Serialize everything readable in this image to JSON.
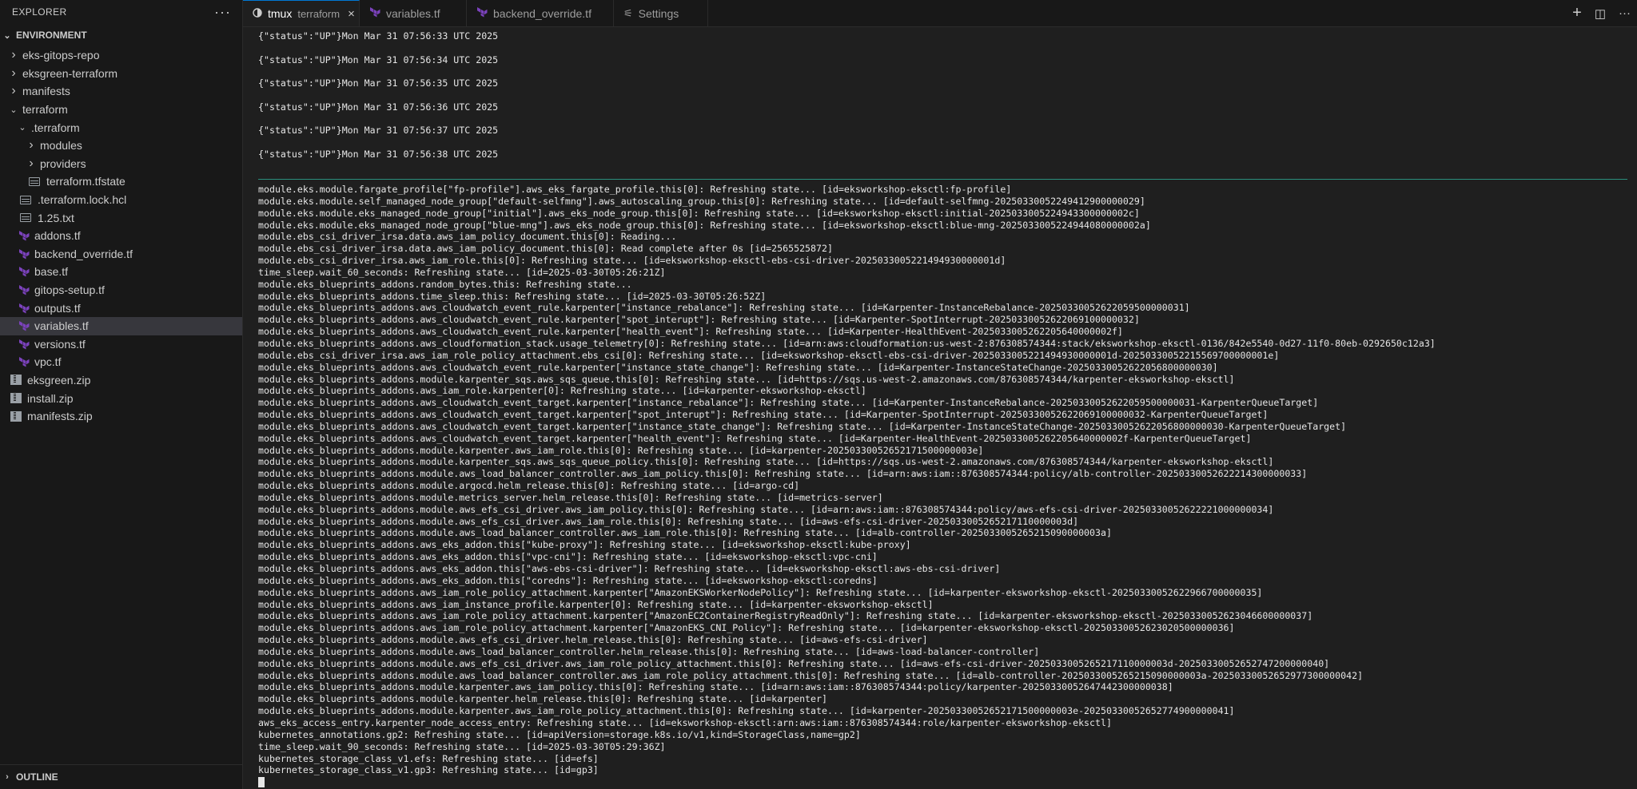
{
  "explorer": {
    "title": "EXPLORER",
    "more": "···",
    "section": "ENVIRONMENT",
    "outline": "OUTLINE",
    "tree": [
      {
        "label": "eks-gitops-repo",
        "kind": "folder",
        "open": false,
        "depth": 0
      },
      {
        "label": "eksgreen-terraform",
        "kind": "folder",
        "open": false,
        "depth": 0
      },
      {
        "label": "manifests",
        "kind": "folder",
        "open": false,
        "depth": 0
      },
      {
        "label": "terraform",
        "kind": "folder",
        "open": true,
        "depth": 0
      },
      {
        "label": ".terraform",
        "kind": "folder",
        "open": true,
        "depth": 1
      },
      {
        "label": "modules",
        "kind": "folder",
        "open": false,
        "depth": 2
      },
      {
        "label": "providers",
        "kind": "folder",
        "open": false,
        "depth": 2
      },
      {
        "label": "terraform.tfstate",
        "kind": "file",
        "depth": 2
      },
      {
        "label": ".terraform.lock.hcl",
        "kind": "file",
        "depth": 1
      },
      {
        "label": "1.25.txt",
        "kind": "file",
        "depth": 1
      },
      {
        "label": "addons.tf",
        "kind": "tf",
        "depth": 1
      },
      {
        "label": "backend_override.tf",
        "kind": "tf",
        "depth": 1
      },
      {
        "label": "base.tf",
        "kind": "tf",
        "depth": 1
      },
      {
        "label": "gitops-setup.tf",
        "kind": "tf",
        "depth": 1
      },
      {
        "label": "outputs.tf",
        "kind": "tf",
        "depth": 1
      },
      {
        "label": "variables.tf",
        "kind": "tf",
        "depth": 1,
        "selected": true
      },
      {
        "label": "versions.tf",
        "kind": "tf",
        "depth": 1
      },
      {
        "label": "vpc.tf",
        "kind": "tf",
        "depth": 1
      },
      {
        "label": "eksgreen.zip",
        "kind": "zip",
        "depth": 0
      },
      {
        "label": "install.zip",
        "kind": "zip",
        "depth": 0
      },
      {
        "label": "manifests.zip",
        "kind": "zip",
        "depth": 0
      }
    ]
  },
  "tabs": [
    {
      "label": "tmux",
      "sub": "terraform",
      "icon": "terminal-icon",
      "active": true,
      "close": "×"
    },
    {
      "label": "variables.tf",
      "icon": "terraform-icon"
    },
    {
      "label": "backend_override.tf",
      "icon": "terraform-icon"
    },
    {
      "label": "Settings",
      "icon": "settings-icon"
    }
  ],
  "tab_actions": {
    "new": "+",
    "split": "◫",
    "more": "···"
  },
  "colors": {
    "terraform": "#7b42bc",
    "accent": "#0078d4",
    "divider": "#2a8f7c",
    "selected": "#37373d"
  },
  "terminal": {
    "status_lines": [
      "{\"status\":\"UP\"}Mon Mar 31 07:56:33 UTC 2025",
      "{\"status\":\"UP\"}Mon Mar 31 07:56:34 UTC 2025",
      "{\"status\":\"UP\"}Mon Mar 31 07:56:35 UTC 2025",
      "{\"status\":\"UP\"}Mon Mar 31 07:56:36 UTC 2025",
      "{\"status\":\"UP\"}Mon Mar 31 07:56:37 UTC 2025",
      "{\"status\":\"UP\"}Mon Mar 31 07:56:38 UTC 2025"
    ],
    "log_lines": [
      "module.eks.module.fargate_profile[\"fp-profile\"].aws_eks_fargate_profile.this[0]: Refreshing state... [id=eksworkshop-eksctl:fp-profile]",
      "module.eks.module.self_managed_node_group[\"default-selfmng\"].aws_autoscaling_group.this[0]: Refreshing state... [id=default-selfmng-20250330052249412900000029]",
      "module.eks.module.eks_managed_node_group[\"initial\"].aws_eks_node_group.this[0]: Refreshing state... [id=eksworkshop-eksctl:initial-2025033005224943300000002c]",
      "module.eks.module.eks_managed_node_group[\"blue-mng\"].aws_eks_node_group.this[0]: Refreshing state... [id=eksworkshop-eksctl:blue-mng-2025033005224944080000002a]",
      "module.ebs_csi_driver_irsa.data.aws_iam_policy_document.this[0]: Reading...",
      "module.ebs_csi_driver_irsa.data.aws_iam_policy_document.this[0]: Read complete after 0s [id=2565525872]",
      "module.ebs_csi_driver_irsa.aws_iam_role.this[0]: Refreshing state... [id=eksworkshop-eksctl-ebs-csi-driver-2025033005221494930000001d]",
      "time_sleep.wait_60_seconds: Refreshing state... [id=2025-03-30T05:26:21Z]",
      "module.eks_blueprints_addons.random_bytes.this: Refreshing state...",
      "module.eks_blueprints_addons.time_sleep.this: Refreshing state... [id=2025-03-30T05:26:52Z]",
      "module.eks_blueprints_addons.aws_cloudwatch_event_rule.karpenter[\"instance_rebalance\"]: Refreshing state... [id=Karpenter-InstanceRebalance-20250330052622059500000031]",
      "module.eks_blueprints_addons.aws_cloudwatch_event_rule.karpenter[\"spot_interupt\"]: Refreshing state... [id=Karpenter-SpotInterrupt-20250330052622069100000032]",
      "module.eks_blueprints_addons.aws_cloudwatch_event_rule.karpenter[\"health_event\"]: Refreshing state... [id=Karpenter-HealthEvent-2025033005262205640000002f]",
      "module.eks_blueprints_addons.aws_cloudformation_stack.usage_telemetry[0]: Refreshing state... [id=arn:aws:cloudformation:us-west-2:876308574344:stack/eksworkshop-eksctl-0136/842e5540-0d27-11f0-80eb-0292650c12a3]",
      "module.ebs_csi_driver_irsa.aws_iam_role_policy_attachment.ebs_csi[0]: Refreshing state... [id=eksworkshop-eksctl-ebs-csi-driver-2025033005221494930000001d-20250330052215569700000001e]",
      "module.eks_blueprints_addons.aws_cloudwatch_event_rule.karpenter[\"instance_state_change\"]: Refreshing state... [id=Karpenter-InstanceStateChange-20250330052622056800000030]",
      "module.eks_blueprints_addons.module.karpenter_sqs.aws_sqs_queue.this[0]: Refreshing state... [id=https://sqs.us-west-2.amazonaws.com/876308574344/karpenter-eksworkshop-eksctl]",
      "module.eks_blueprints_addons.aws_iam_role.karpenter[0]: Refreshing state... [id=karpenter-eksworkshop-eksctl]",
      "module.eks_blueprints_addons.aws_cloudwatch_event_target.karpenter[\"instance_rebalance\"]: Refreshing state... [id=Karpenter-InstanceRebalance-20250330052622059500000031-KarpenterQueueTarget]",
      "module.eks_blueprints_addons.aws_cloudwatch_event_target.karpenter[\"spot_interupt\"]: Refreshing state... [id=Karpenter-SpotInterrupt-20250330052622069100000032-KarpenterQueueTarget]",
      "module.eks_blueprints_addons.aws_cloudwatch_event_target.karpenter[\"instance_state_change\"]: Refreshing state... [id=Karpenter-InstanceStateChange-20250330052622056800000030-KarpenterQueueTarget]",
      "module.eks_blueprints_addons.aws_cloudwatch_event_target.karpenter[\"health_event\"]: Refreshing state... [id=Karpenter-HealthEvent-2025033005262205640000002f-KarpenterQueueTarget]",
      "module.eks_blueprints_addons.module.karpenter.aws_iam_role.this[0]: Refreshing state... [id=karpenter-20250330052652171500000003e]",
      "module.eks_blueprints_addons.module.karpenter_sqs.aws_sqs_queue_policy.this[0]: Refreshing state... [id=https://sqs.us-west-2.amazonaws.com/876308574344/karpenter-eksworkshop-eksctl]",
      "module.eks_blueprints_addons.module.aws_load_balancer_controller.aws_iam_policy.this[0]: Refreshing state... [id=arn:aws:iam::876308574344:policy/alb-controller-20250330052622214300000033]",
      "module.eks_blueprints_addons.module.argocd.helm_release.this[0]: Refreshing state... [id=argo-cd]",
      "module.eks_blueprints_addons.module.metrics_server.helm_release.this[0]: Refreshing state... [id=metrics-server]",
      "module.eks_blueprints_addons.module.aws_efs_csi_driver.aws_iam_policy.this[0]: Refreshing state... [id=arn:aws:iam::876308574344:policy/aws-efs-csi-driver-20250330052622221000000034]",
      "module.eks_blueprints_addons.module.aws_efs_csi_driver.aws_iam_role.this[0]: Refreshing state... [id=aws-efs-csi-driver-2025033005265217110000003d]",
      "module.eks_blueprints_addons.module.aws_load_balancer_controller.aws_iam_role.this[0]: Refreshing state... [id=alb-controller-2025033005265215090000003a]",
      "module.eks_blueprints_addons.aws_eks_addon.this[\"kube-proxy\"]: Refreshing state... [id=eksworkshop-eksctl:kube-proxy]",
      "module.eks_blueprints_addons.aws_eks_addon.this[\"vpc-cni\"]: Refreshing state... [id=eksworkshop-eksctl:vpc-cni]",
      "module.eks_blueprints_addons.aws_eks_addon.this[\"aws-ebs-csi-driver\"]: Refreshing state... [id=eksworkshop-eksctl:aws-ebs-csi-driver]",
      "module.eks_blueprints_addons.aws_eks_addon.this[\"coredns\"]: Refreshing state... [id=eksworkshop-eksctl:coredns]",
      "module.eks_blueprints_addons.aws_iam_role_policy_attachment.karpenter[\"AmazonEKSWorkerNodePolicy\"]: Refreshing state... [id=karpenter-eksworkshop-eksctl-20250330052622966700000035]",
      "module.eks_blueprints_addons.aws_iam_instance_profile.karpenter[0]: Refreshing state... [id=karpenter-eksworkshop-eksctl]",
      "module.eks_blueprints_addons.aws_iam_role_policy_attachment.karpenter[\"AmazonEC2ContainerRegistryReadOnly\"]: Refreshing state... [id=karpenter-eksworkshop-eksctl-20250330052623046600000037]",
      "module.eks_blueprints_addons.aws_iam_role_policy_attachment.karpenter[\"AmazonEKS_CNI_Policy\"]: Refreshing state... [id=karpenter-eksworkshop-eksctl-20250330052623020500000036]",
      "module.eks_blueprints_addons.module.aws_efs_csi_driver.helm_release.this[0]: Refreshing state... [id=aws-efs-csi-driver]",
      "module.eks_blueprints_addons.module.aws_load_balancer_controller.helm_release.this[0]: Refreshing state... [id=aws-load-balancer-controller]",
      "module.eks_blueprints_addons.module.aws_efs_csi_driver.aws_iam_role_policy_attachment.this[0]: Refreshing state... [id=aws-efs-csi-driver-2025033005265217110000003d-20250330052652747200000040]",
      "module.eks_blueprints_addons.module.aws_load_balancer_controller.aws_iam_role_policy_attachment.this[0]: Refreshing state... [id=alb-controller-2025033005265215090000003a-20250330052652977300000042]",
      "module.eks_blueprints_addons.module.karpenter.aws_iam_policy.this[0]: Refreshing state... [id=arn:aws:iam::876308574344:policy/karpenter-20250330052647442300000038]",
      "module.eks_blueprints_addons.module.karpenter.helm_release.this[0]: Refreshing state... [id=karpenter]",
      "module.eks_blueprints_addons.module.karpenter.aws_iam_role_policy_attachment.this[0]: Refreshing state... [id=karpenter-20250330052652171500000003e-20250330052652774900000041]",
      "aws_eks_access_entry.karpenter_node_access_entry: Refreshing state... [id=eksworkshop-eksctl:arn:aws:iam::876308574344:role/karpenter-eksworkshop-eksctl]",
      "kubernetes_annotations.gp2: Refreshing state... [id=apiVersion=storage.k8s.io/v1,kind=StorageClass,name=gp2]",
      "time_sleep.wait_90_seconds: Refreshing state... [id=2025-03-30T05:29:36Z]",
      "kubernetes_storage_class_v1.efs: Refreshing state... [id=efs]",
      "kubernetes_storage_class_v1.gp3: Refreshing state... [id=gp3]"
    ]
  }
}
